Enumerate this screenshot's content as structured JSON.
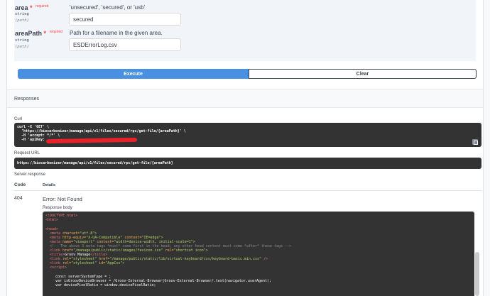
{
  "params": [
    {
      "name": "area",
      "required_star": "*",
      "required_label": "required",
      "type": "string",
      "location": "(path)",
      "description": "'unsecured', 'secured', or 'usb'",
      "value": "secured"
    },
    {
      "name": "areaPath",
      "required_star": "*",
      "required_label": "required",
      "type": "string",
      "location": "(path)",
      "description": "Path for a filename in the given area.",
      "value": "ESDErrorLog.csv"
    }
  ],
  "buttons": {
    "execute": "Execute",
    "clear": "Clear"
  },
  "responses": {
    "title": "Responses",
    "curl_label": "Curl",
    "curl_lines": [
      "curl -X 'GET' \\",
      "  'https://biocarbonizer/manage/api/v1/files/secured/rpc/get-file/{areaPath}' \\",
      "  -H 'accept: */*' \\",
      "  -H 'apiKey:"
    ],
    "request_url_label": "Request URL",
    "request_url": "https://biocarbonizer/manage/api/v1/files/secured/rpc/get-file/{areaPath}",
    "server_response_label": "Server response",
    "code_header": "Code",
    "details_header": "Details",
    "code": "404",
    "error_text": "Error: Not Found",
    "response_body_label": "Response body"
  },
  "response_body": {
    "l1": "<!DOCTYPE html>",
    "l2": "<html>",
    "l3": "<head>",
    "l4_tag": "<meta",
    "l4_attr": "charset=",
    "l4_val": "\"utf-8\">",
    "l5_tag": "<meta",
    "l5_attr": "http-equiv=",
    "l5_val": "\"X-UA-Compatible\"",
    "l5_attr2": "content=",
    "l5_val2": "\"IE=edge\">",
    "l6_tag": "<meta",
    "l6_attr": "name=",
    "l6_val": "\"viewport\"",
    "l6_attr2": "content=",
    "l6_val2": "\"width=device-width, initial-scale=1\">",
    "l7": "<!-- The above 3 meta tags *must* come first in the head; any other head content must come *after* these tags -->",
    "l8_tag": "<link",
    "l8_attr": "href=",
    "l8_val": "\"/manage/public/static/images/favicon.ico\"",
    "l8_attr2": "rel=",
    "l8_val2": "\"shortcut icon\">",
    "l9_open": "<title>",
    "l9_text": "Groov Manage",
    "l9_close": "</title>",
    "l10_tag": "<link",
    "l10_attr": "rel=",
    "l10_val": "\"stylesheet\"",
    "l10_attr2": "href=",
    "l10_val2": "\"/manage/public/static/lib/virtual-keyboard/css/keyboard-basic.min.css\"",
    "l10_end": "/>",
    "l11_tag": "<link",
    "l11_attr": "rel=",
    "l11_val": "\"stylesheet\"",
    "l11_attr2": "id=",
    "l11_val2": "\"AppCss\">",
    "l12": "<script>",
    "l13": "const serverSystemType = ;",
    "l14": "var isGroovDeviceBrowser = /Groov-Internal-Browser|Groov-External-Browser/.test(navigator.userAgent);",
    "l15": "var devicePixelRatio = window.devicePixelRatio;"
  }
}
